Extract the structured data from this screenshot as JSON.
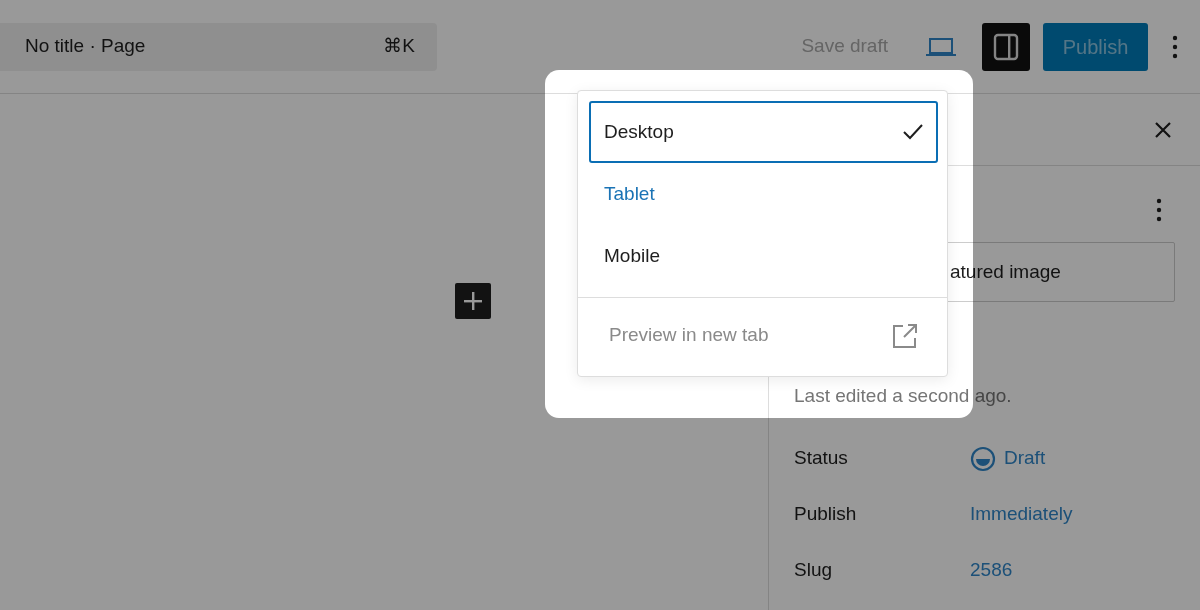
{
  "header": {
    "command_bar": {
      "title": "No title · Page",
      "shortcut": "⌘K"
    },
    "save_draft": "Save draft",
    "settings_toggle": {
      "on": true
    },
    "publish": "Publish"
  },
  "sidebar": {
    "featured_image": "atured image",
    "last_edited": "Last edited a second ago.",
    "fields": [
      {
        "label": "Status",
        "value": "Draft",
        "kind": "status"
      },
      {
        "label": "Publish",
        "value": "Immediately",
        "kind": "link"
      },
      {
        "label": "Slug",
        "value": "2586",
        "kind": "link"
      }
    ]
  },
  "preview_menu": {
    "devices": [
      {
        "label": "Desktop",
        "selected": true,
        "hovered": false
      },
      {
        "label": "Tablet",
        "selected": false,
        "hovered": true
      },
      {
        "label": "Mobile",
        "selected": false,
        "hovered": false
      }
    ],
    "preview_link": {
      "label": "Preview in new tab",
      "disabled": true
    }
  }
}
